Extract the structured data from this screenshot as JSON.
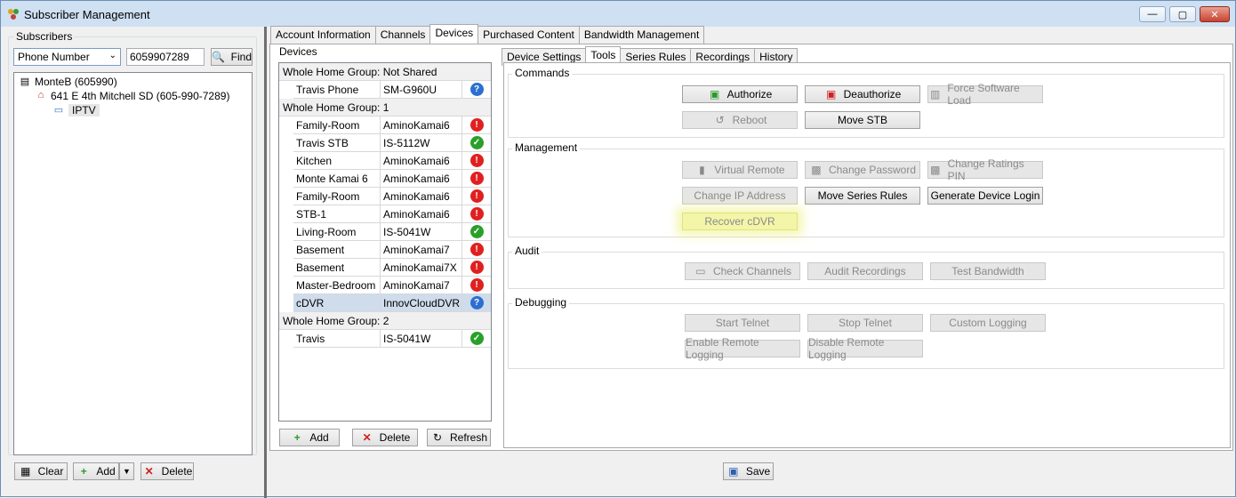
{
  "window": {
    "title": "Subscriber Management",
    "controls": {
      "minimize": "—",
      "maximize": "▢",
      "close": "✕"
    }
  },
  "subscribers": {
    "group_label": "Subscribers",
    "search_type": "Phone Number",
    "search_value": "6059907289",
    "find_label": "Find",
    "tree": {
      "account": "MonteB (605990)",
      "address": "641 E 4th   Mitchell SD (605-990-7289)",
      "service": "IPTV"
    },
    "buttons": {
      "clear": "Clear",
      "add": "Add",
      "delete": "Delete"
    }
  },
  "tabs": [
    "Account Information",
    "Channels",
    "Devices",
    "Purchased Content",
    "Bandwidth Management"
  ],
  "active_tab": "Devices",
  "devices": {
    "label": "Devices",
    "groups": [
      {
        "header": "Whole Home Group: Not Shared",
        "rows": [
          {
            "name": "Travis Phone",
            "model": "SM-G960U",
            "status": "unknown"
          }
        ]
      },
      {
        "header": "Whole Home Group: 1",
        "rows": [
          {
            "name": "Family-Room",
            "model": "AminoKamai6",
            "status": "error"
          },
          {
            "name": "Travis STB",
            "model": "IS-5112W",
            "status": "ok"
          },
          {
            "name": "Kitchen",
            "model": "AminoKamai6",
            "status": "error"
          },
          {
            "name": "Monte Kamai 6",
            "model": "AminoKamai6",
            "status": "error"
          },
          {
            "name": "Family-Room",
            "model": "AminoKamai6",
            "status": "error"
          },
          {
            "name": "STB-1",
            "model": "AminoKamai6",
            "status": "error"
          },
          {
            "name": "Living-Room",
            "model": "IS-5041W",
            "status": "ok"
          },
          {
            "name": "Basement",
            "model": "AminoKamai7",
            "status": "error"
          },
          {
            "name": "Basement",
            "model": "AminoKamai7X",
            "status": "error"
          },
          {
            "name": "Master-Bedroom",
            "model": "AminoKamai7",
            "status": "error"
          },
          {
            "name": "cDVR",
            "model": "InnovCloudDVR",
            "status": "unknown",
            "selected": true
          }
        ]
      },
      {
        "header": "Whole Home Group: 2",
        "rows": [
          {
            "name": "Travis",
            "model": "IS-5041W",
            "status": "ok"
          }
        ]
      }
    ],
    "buttons": {
      "add": "Add",
      "delete": "Delete",
      "refresh": "Refresh"
    }
  },
  "device_tabs": [
    "Device Settings",
    "Tools",
    "Series Rules",
    "Recordings",
    "History"
  ],
  "active_device_tab": "Tools",
  "tools": {
    "commands": {
      "title": "Commands",
      "authorize": "Authorize",
      "deauthorize": "Deauthorize",
      "force_software_load": "Force Software Load",
      "reboot": "Reboot",
      "move_stb": "Move STB"
    },
    "management": {
      "title": "Management",
      "virtual_remote": "Virtual Remote",
      "change_password": "Change Password",
      "change_ratings_pin": "Change Ratings PIN",
      "change_ip": "Change IP Address",
      "move_series_rules": "Move Series Rules",
      "generate_device_login": "Generate Device Login",
      "recover_cdvr": "Recover cDVR"
    },
    "audit": {
      "title": "Audit",
      "check_channels": "Check Channels",
      "audit_recordings": "Audit Recordings",
      "test_bandwidth": "Test Bandwidth"
    },
    "debugging": {
      "title": "Debugging",
      "start_telnet": "Start Telnet",
      "stop_telnet": "Stop Telnet",
      "custom_logging": "Custom Logging",
      "enable_remote_logging": "Enable Remote Logging",
      "disable_remote_logging": "Disable Remote Logging"
    }
  },
  "save_label": "Save",
  "colors": {
    "error": "#e02020",
    "ok": "#2aa02a",
    "unknown": "#2c6fd1",
    "highlight": "#f3f6a8"
  }
}
